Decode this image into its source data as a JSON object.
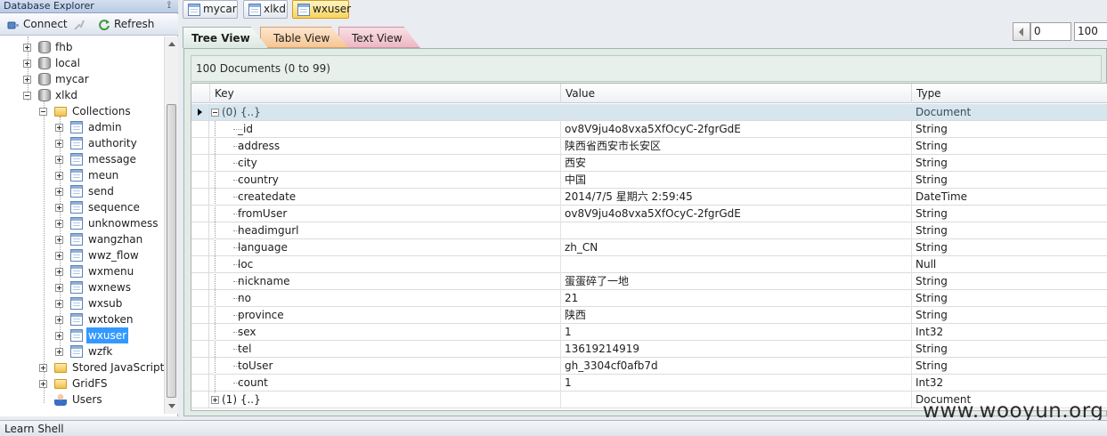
{
  "panel": {
    "title": "Database Explorer",
    "pin_glyph": "⟟"
  },
  "toolbar": {
    "connect": "Connect",
    "refresh": "Refresh"
  },
  "tree": {
    "databases": [
      "fhb",
      "local",
      "mycar",
      "xlkd"
    ],
    "collections_label": "Collections",
    "collections": [
      "admin",
      "authority",
      "message",
      "meun",
      "send",
      "sequence",
      "unknowmess",
      "wangzhan",
      "wwz_flow",
      "wxmenu",
      "wxnews",
      "wxsub",
      "wxtoken",
      "wxuser",
      "wzfk"
    ],
    "selected_collection": "wxuser",
    "stored_js_label": "Stored JavaScript",
    "gridfs_label": "GridFS",
    "users_label": "Users"
  },
  "doc_tabs": [
    {
      "label": "mycar",
      "active": false
    },
    {
      "label": "xlkd",
      "active": false
    },
    {
      "label": "wxuser",
      "active": true
    }
  ],
  "view_tabs": {
    "tree": "Tree View",
    "table": "Table View",
    "text": "Text View"
  },
  "paging": {
    "skip": "0",
    "limit": "100"
  },
  "doc_count": "100 Documents (0 to 99)",
  "grid": {
    "columns": {
      "key": "Key",
      "value": "Value",
      "type": "Type"
    },
    "doc0": {
      "key": "(0) {..}",
      "value": "",
      "type": "Document"
    },
    "fields": [
      {
        "key": "_id",
        "value": "ov8V9ju4o8vxa5XfOcyC-2fgrGdE",
        "type": "String"
      },
      {
        "key": "address",
        "value": "陕西省西安市长安区",
        "type": "String"
      },
      {
        "key": "city",
        "value": "西安",
        "type": "String"
      },
      {
        "key": "country",
        "value": "中国",
        "type": "String"
      },
      {
        "key": "createdate",
        "value": "2014/7/5 星期六 2:59:45",
        "type": "DateTime"
      },
      {
        "key": "fromUser",
        "value": "ov8V9ju4o8vxa5XfOcyC-2fgrGdE",
        "type": "String"
      },
      {
        "key": "headimgurl",
        "value": "",
        "type": "String"
      },
      {
        "key": "language",
        "value": "zh_CN",
        "type": "String"
      },
      {
        "key": "loc",
        "value": "",
        "type": "Null"
      },
      {
        "key": "nickname",
        "value": "蛋蛋碎了一地",
        "type": "String"
      },
      {
        "key": "no",
        "value": "21",
        "type": "String"
      },
      {
        "key": "province",
        "value": "陕西",
        "type": "String"
      },
      {
        "key": "sex",
        "value": "1",
        "type": "Int32"
      },
      {
        "key": "tel",
        "value": "13619214919",
        "type": "String"
      },
      {
        "key": "toUser",
        "value": "gh_3304cf0afb7d",
        "type": "String"
      },
      {
        "key": "count",
        "value": "1",
        "type": "Int32"
      }
    ],
    "doc1": {
      "key": "(1) {..}",
      "value": "",
      "type": "Document"
    }
  },
  "status_bar": "Learn Shell",
  "watermark": "www.wooyun.org",
  "colors": {
    "selection": "#3399ff",
    "group_row": "#d7e5ee",
    "active_doc_tab": "#f7d35e"
  }
}
